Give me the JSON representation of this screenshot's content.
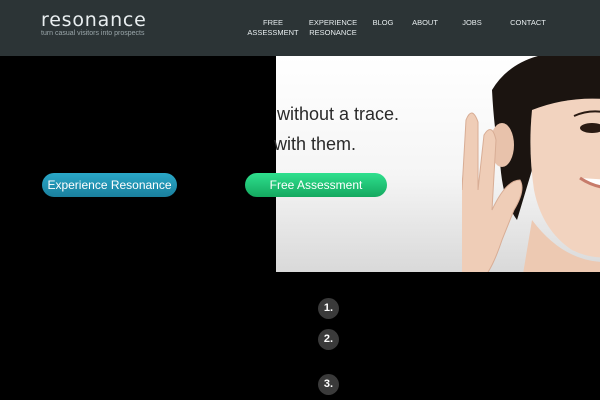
{
  "header": {
    "logo": "resonance",
    "tagline": "turn casual visitors into prospects"
  },
  "nav": {
    "items": [
      {
        "label": "FREE\nASSESSMENT"
      },
      {
        "label": "EXPERIENCE\nRESONANCE"
      },
      {
        "label": "BLOG"
      },
      {
        "label": "ABOUT"
      },
      {
        "label": "JOBS"
      },
      {
        "label": "CONTACT"
      }
    ]
  },
  "hero": {
    "line1": "without a trace.",
    "line2": "with them.",
    "image": "woman-listening-hand-to-ear"
  },
  "buttons": {
    "experience": "Experience Resonance",
    "free_assessment": "Free Assessment"
  },
  "steps": [
    "1.",
    "2.",
    "3."
  ],
  "colors": {
    "header_bg": "#2c3436",
    "page_bg": "#000000",
    "experience_button": "#1a8fad",
    "free_button": "#1cc873"
  }
}
